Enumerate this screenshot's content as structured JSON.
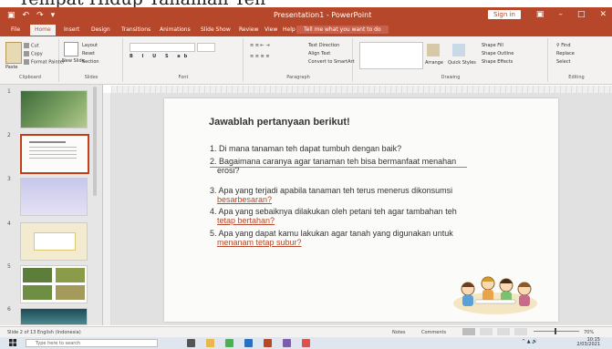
{
  "caption": {
    "text": "Tempat Hidup Tanaman Teh"
  },
  "window": {
    "title": "Presentation1 - PowerPoint",
    "sign_in": "Sign in"
  },
  "tabs": [
    {
      "label": "File"
    },
    {
      "label": "Home"
    },
    {
      "label": "Insert"
    },
    {
      "label": "Design"
    },
    {
      "label": "Transitions"
    },
    {
      "label": "Animations"
    },
    {
      "label": "Slide Show"
    },
    {
      "label": "Review"
    },
    {
      "label": "View"
    },
    {
      "label": "Help"
    }
  ],
  "tell_me": "Tell me what you want to do",
  "ribbon": {
    "clipboard": {
      "paste": "Paste",
      "cut": "Cut",
      "copy": "Copy",
      "format_painter": "Format Painter",
      "label": "Clipboard"
    },
    "slides": {
      "new_slide": "New Slide",
      "layout": "Layout",
      "reset": "Reset",
      "section": "Section",
      "label": "Slides"
    },
    "font": {
      "label": "Font"
    },
    "paragraph": {
      "text_direction": "Text Direction",
      "align_text": "Align Text",
      "convert_smartart": "Convert to SmartArt",
      "label": "Paragraph"
    },
    "drawing": {
      "arrange": "Arrange",
      "quick_styles": "Quick Styles",
      "shape_fill": "Shape Fill",
      "shape_outline": "Shape Outline",
      "shape_effects": "Shape Effects",
      "label": "Drawing"
    },
    "editing": {
      "find": "Find",
      "replace": "Replace",
      "select": "Select",
      "label": "Editing"
    }
  },
  "thumbnails": [
    {
      "num": "1"
    },
    {
      "num": "2"
    },
    {
      "num": "3"
    },
    {
      "num": "4"
    },
    {
      "num": "5"
    },
    {
      "num": "6"
    }
  ],
  "slide": {
    "heading": "Jawablah pertanyaan berikut!",
    "questions": [
      {
        "line1": "1. Di mana tanaman teh dapat tumbuh dengan baik?",
        "line2": ""
      },
      {
        "line1": "2. Bagaimana caranya agar tanaman teh bisa bermanfaat menahan",
        "line2": "erosi?"
      },
      {
        "line1": "3. Apa yang terjadi apabila tanaman teh terus menerus dikonsumsi",
        "line2": "besarbesaran?"
      },
      {
        "line1": "4. Apa yang sebaiknya dilakukan oleh petani teh agar tambahan teh",
        "line2": "tetap bertahan?"
      },
      {
        "line1": "5. Apa yang dapat kamu lakukan agar tanah yang digunakan untuk",
        "line2": "menanam tetap subur?"
      }
    ]
  },
  "statusbar": {
    "slide_info": "Slide 2 of 13   English (Indonesia)",
    "notes": "Notes",
    "comments": "Comments",
    "zoom": "70%"
  },
  "taskbar": {
    "search_placeholder": "Type here to search",
    "time": "10:15",
    "date": "2/03/2021"
  },
  "colors": {
    "accent": "#b7472a",
    "slide_bg": "#fbfbf9",
    "work_bg": "#e1e1e1"
  }
}
